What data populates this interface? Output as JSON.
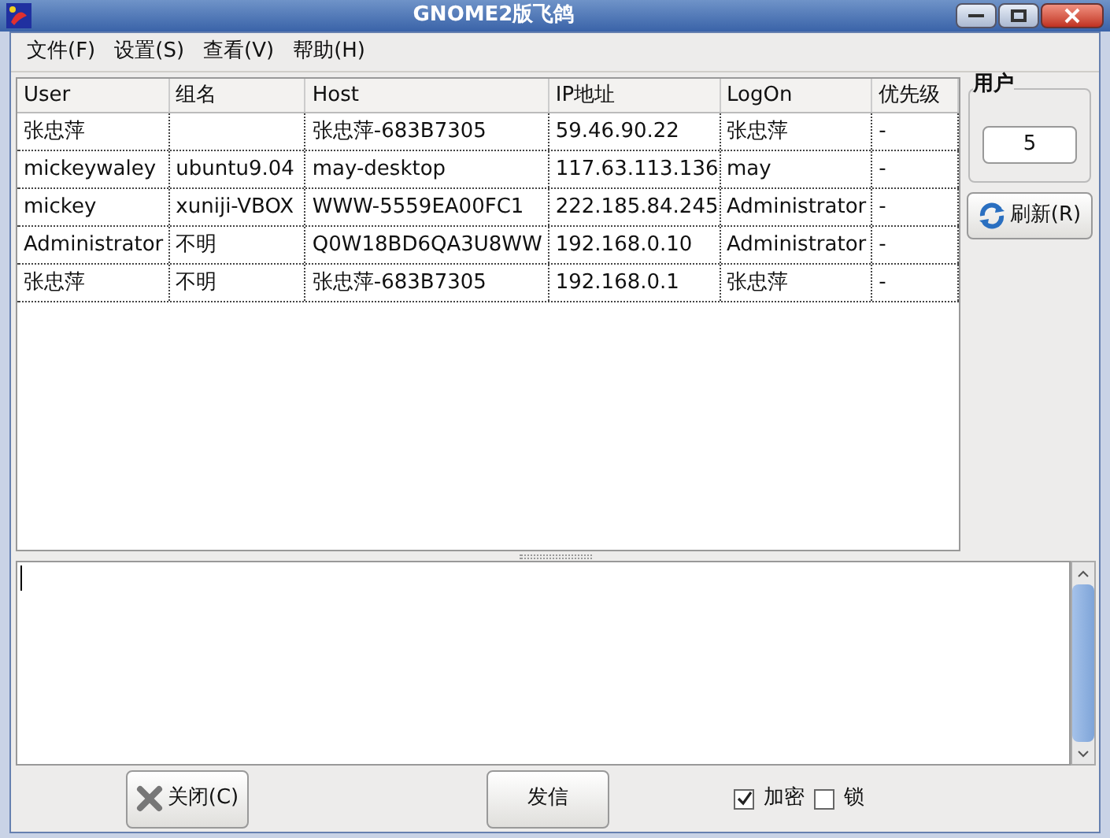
{
  "window": {
    "title": "GNOME2版飞鸽"
  },
  "menu": [
    "文件(F)",
    "设置(S)",
    "查看(V)",
    "帮助(H)"
  ],
  "table": {
    "columns": [
      "User",
      "组名",
      "Host",
      "IP地址",
      "LogOn",
      "优先级"
    ],
    "rows": [
      [
        "张忠萍",
        "",
        "张忠萍-683B7305",
        "59.46.90.22",
        "张忠萍",
        "-"
      ],
      [
        "mickeywaley",
        "ubuntu9.04",
        "may-desktop",
        "117.63.113.136",
        "may",
        "-"
      ],
      [
        "mickey",
        "xuniji-VBOX",
        "WWW-5559EA00FC1",
        "222.185.84.245",
        "Administrator",
        "-"
      ],
      [
        "Administrator",
        "不明",
        "Q0W18BD6QA3U8WW",
        "192.168.0.10",
        "Administrator",
        "-"
      ],
      [
        "张忠萍",
        "不明",
        "张忠萍-683B7305",
        "192.168.0.1",
        "张忠萍",
        "-"
      ]
    ]
  },
  "users_panel": {
    "title": "用户",
    "count": "5",
    "refresh": "刷新(R)"
  },
  "close_button": "关闭(C)",
  "send_button": "发信",
  "options": [
    {
      "label": "加密",
      "checked": true
    },
    {
      "label": "锁",
      "checked": false
    }
  ]
}
